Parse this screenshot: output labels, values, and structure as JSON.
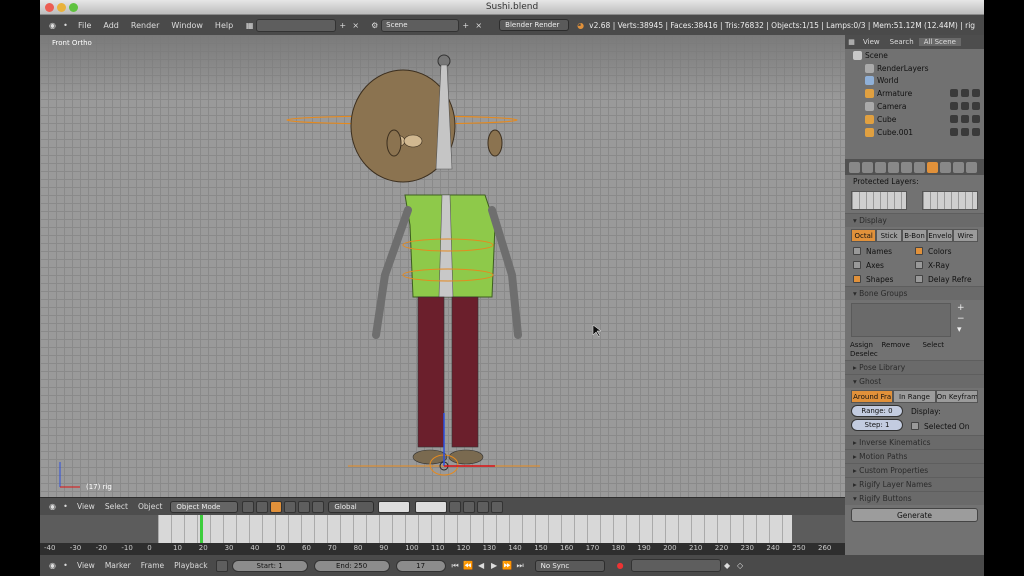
{
  "window": {
    "title": "Sushi.blend"
  },
  "infobar": {
    "menus": [
      "File",
      "Add",
      "Render",
      "Window",
      "Help"
    ],
    "screen_value": "",
    "scene_value": "Scene",
    "engine": "Blender Render",
    "stats": "v2.68 | Verts:38945 | Faces:38416 | Tris:76832 | Objects:1/15 | Lamps:0/3 | Mem:51.12M (12.44M) | rig"
  },
  "viewport": {
    "label": "Front Ortho",
    "frame_label": "(17) rig"
  },
  "vp_header": {
    "menus": [
      "View",
      "Select",
      "Object"
    ],
    "mode": "Object Mode",
    "orientation": "Global"
  },
  "ruler": {
    "ticks": [
      "-40",
      "-30",
      "-20",
      "-10",
      "0",
      "10",
      "20",
      "30",
      "40",
      "50",
      "60",
      "70",
      "80",
      "90",
      "100",
      "110",
      "120",
      "130",
      "140",
      "150",
      "160",
      "170",
      "180",
      "190",
      "200",
      "210",
      "220",
      "230",
      "240",
      "250",
      "260"
    ]
  },
  "bottombar": {
    "menus": [
      "View",
      "Marker",
      "Frame",
      "Playback"
    ],
    "start": "Start: 1",
    "end": "End: 250",
    "current": "17",
    "sync": "No Sync"
  },
  "outliner": {
    "tabs": [
      "View",
      "Search",
      "All Scene"
    ],
    "rows": [
      {
        "label": "Scene",
        "icon": "scene-icon"
      },
      {
        "label": "RenderLayers",
        "icon": "renderlayers-icon"
      },
      {
        "label": "World",
        "icon": "world-icon"
      },
      {
        "label": "Armature",
        "icon": "armature-icon"
      },
      {
        "label": "Camera",
        "icon": "camera-icon"
      },
      {
        "label": "Cube",
        "icon": "mesh-icon"
      },
      {
        "label": "Cube.001",
        "icon": "mesh-icon"
      }
    ]
  },
  "properties": {
    "protected_layers": "Protected Layers:",
    "display": {
      "title": "Display",
      "modes": [
        "Octal",
        "Stick",
        "B-Bon",
        "Envelo",
        "Wire"
      ],
      "active_mode": "Octal",
      "checks": [
        {
          "label": "Names",
          "on": false
        },
        {
          "label": "Colors",
          "on": true
        },
        {
          "label": "Axes",
          "on": false
        },
        {
          "label": "X-Ray",
          "on": false
        },
        {
          "label": "Shapes",
          "on": true
        },
        {
          "label": "Delay Refre",
          "on": false
        }
      ]
    },
    "bone_groups": {
      "title": "Bone Groups",
      "buttons": [
        "Assign",
        "Remove",
        "Select",
        "Deselec"
      ]
    },
    "pose_library": "Pose Library",
    "ghost": {
      "title": "Ghost",
      "modes": [
        "Around Fra",
        "In Range",
        "On Keyfram"
      ],
      "range": "Range: 0",
      "step": "Step: 1",
      "display_label": "Display:",
      "selected_only": "Selected On"
    },
    "collapsed": [
      "Inverse Kinematics",
      "Motion Paths",
      "Custom Properties",
      "Rigify Layer Names",
      "Rigify Buttons"
    ],
    "generate": "Generate"
  }
}
